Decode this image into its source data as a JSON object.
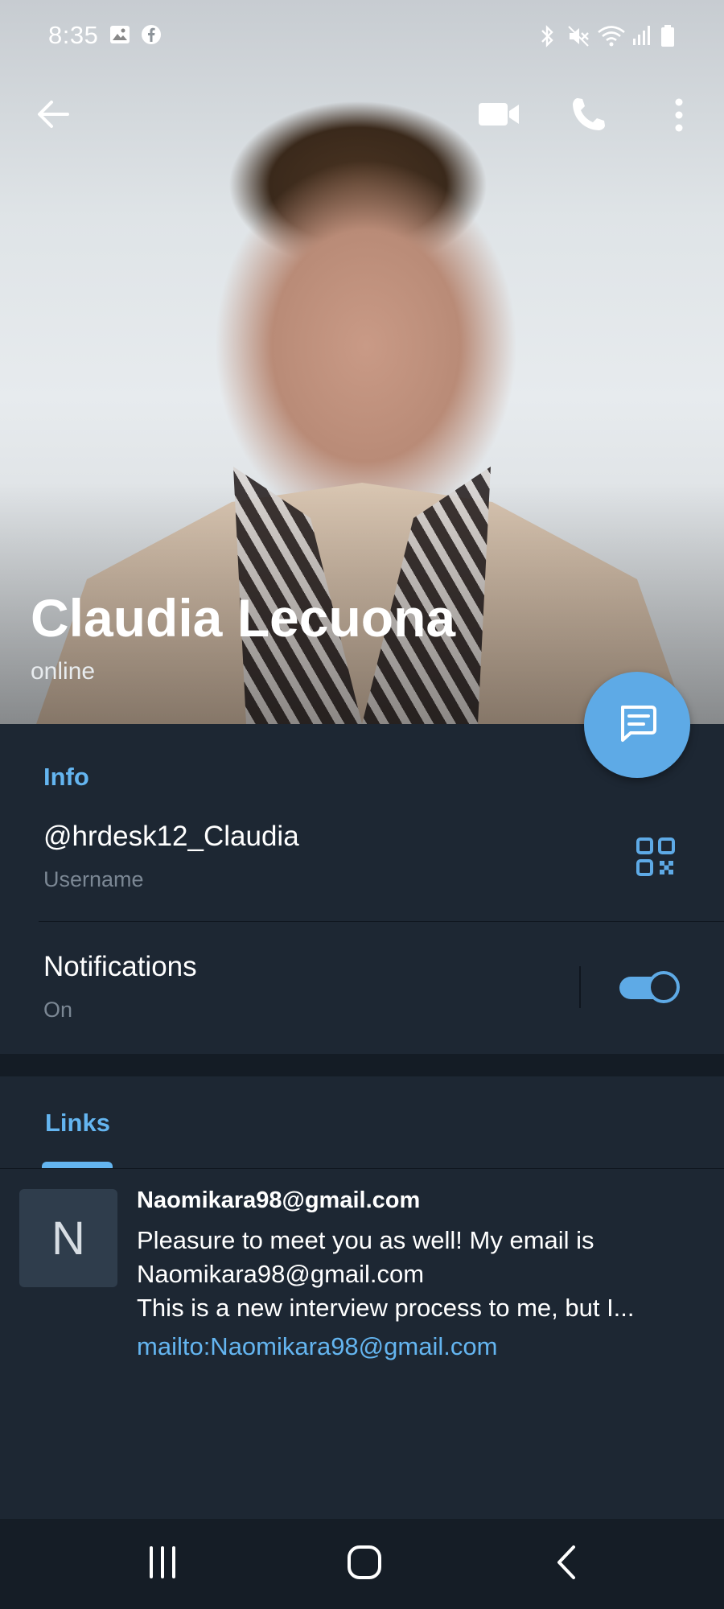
{
  "status_bar": {
    "time": "8:35",
    "icons": [
      "gallery-icon",
      "facebook-icon",
      "bluetooth-icon",
      "mute-icon",
      "wifi-icon",
      "signal-icon",
      "battery-icon"
    ]
  },
  "toolbar": {
    "icons": [
      "back-arrow-icon",
      "video-call-icon",
      "phone-icon",
      "more-vertical-icon"
    ]
  },
  "profile": {
    "name": "Claudia Lecuona",
    "status": "online"
  },
  "info": {
    "title": "Info",
    "username": "@hrdesk12_Claudia",
    "username_label": "Username",
    "notifications_label": "Notifications",
    "notifications_state": "On",
    "notifications_enabled": true
  },
  "links": {
    "tab_label": "Links",
    "items": [
      {
        "avatar_letter": "N",
        "title": "Naomikara98@gmail.com",
        "line1": "Pleasure to meet you as well! My email is",
        "line2": "Naomikara98@gmail.com",
        "line3": "This is a new interview process to me, but I...",
        "link": "mailto:Naomikara98@gmail.com"
      }
    ]
  },
  "colors": {
    "accent": "#5eaae6",
    "section_title": "#64b5f0",
    "background": "#1d2733",
    "link": "#64b5f0"
  }
}
